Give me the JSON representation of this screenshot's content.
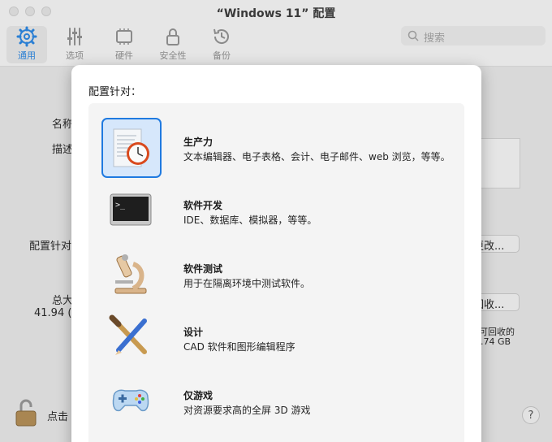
{
  "window": {
    "title": "“Windows 11” 配置"
  },
  "toolbar": {
    "items": [
      {
        "label": "通用",
        "icon": "gear-icon",
        "active": true
      },
      {
        "label": "选项",
        "icon": "sliders-icon",
        "active": false
      },
      {
        "label": "硬件",
        "icon": "chip-icon",
        "active": false
      },
      {
        "label": "安全性",
        "icon": "lock-icon",
        "active": false
      },
      {
        "label": "备份",
        "icon": "history-clock-icon",
        "active": false
      }
    ],
    "search_placeholder": "搜索"
  },
  "background": {
    "name_label": "名称",
    "desc_label": "描述",
    "config_label": "配置针对",
    "change_button": "更改...",
    "total_label": "总大",
    "total_value": "41.94 (",
    "reclaim_button": "回收...",
    "reclaimable_label": "可回收的",
    "reclaimable_value": ".74 GB",
    "lock_text": "点击"
  },
  "sheet": {
    "heading": "配置针对：",
    "profiles": [
      {
        "name": "生产力",
        "desc": "文本编辑器、电子表格、会计、电子邮件、web 浏览，等等。",
        "icon": "productivity-document-clock-icon",
        "selected": true
      },
      {
        "name": "软件开发",
        "desc": "IDE、数据库、模拟器，等等。",
        "icon": "terminal-icon",
        "selected": false
      },
      {
        "name": "软件测试",
        "desc": "用于在隔离环境中测试软件。",
        "icon": "microscope-icon",
        "selected": false
      },
      {
        "name": "设计",
        "desc": "CAD 软件和图形编辑程序",
        "icon": "brush-pencil-icon",
        "selected": false
      },
      {
        "name": "仅游戏",
        "desc": "对资源要求高的全屏 3D 游戏",
        "icon": "gamepad-icon",
        "selected": false
      }
    ]
  },
  "colors": {
    "accent": "#1f7ae0",
    "selected_bg": "#d6e7fb"
  }
}
